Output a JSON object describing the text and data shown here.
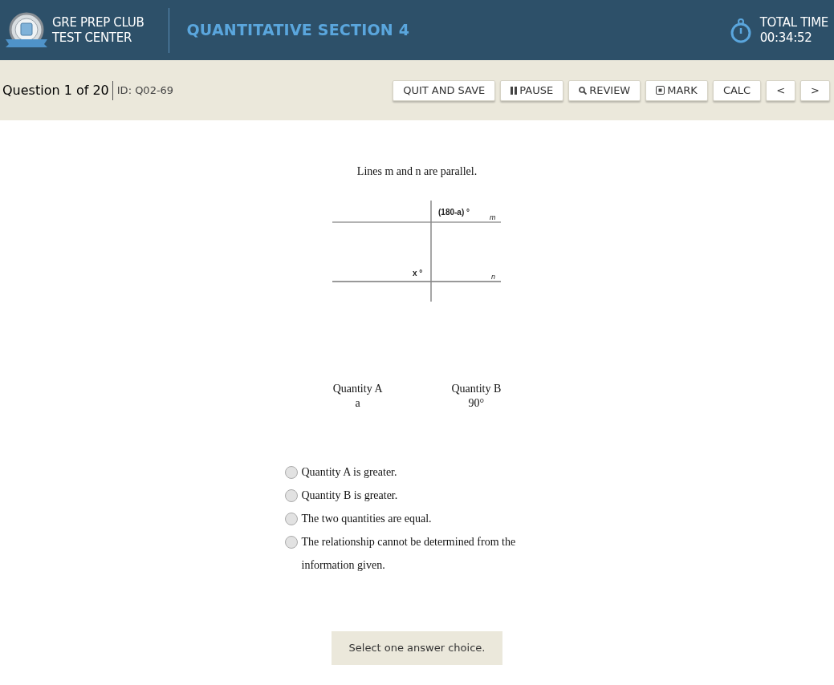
{
  "header": {
    "brand_lines": [
      "GRE PREP CLUB",
      "TEST CENTER"
    ],
    "section_title": "QUANTITATIVE SECTION 4",
    "timer_label": "TOTAL TIME",
    "timer_value": "00:34:52"
  },
  "toolbar": {
    "question_counter": "Question 1 of 20",
    "question_id": "ID: Q02-69",
    "buttons": [
      {
        "label": "QUIT AND SAVE",
        "kind": "plain"
      },
      {
        "label": "PAUSE",
        "kind": "pause"
      },
      {
        "label": "REVIEW",
        "kind": "review"
      },
      {
        "label": "MARK",
        "kind": "mark"
      },
      {
        "label": "CALC",
        "kind": "plain"
      },
      {
        "label": "<",
        "kind": "plain"
      },
      {
        "label": ">",
        "kind": "plain"
      }
    ]
  },
  "question": {
    "stem": "Lines m and n are parallel.",
    "figure_labels": {
      "top_angle": "(180-a) °",
      "line_m": "m",
      "bottom_angle": "x °",
      "line_n": "n"
    },
    "quantity_a": {
      "heading": "Quantity A",
      "value": "a"
    },
    "quantity_b": {
      "heading": "Quantity B",
      "value": "90°"
    },
    "choices": [
      {
        "text": "Quantity A is greater.",
        "selected": false
      },
      {
        "text": "Quantity B is greater.",
        "selected": false
      },
      {
        "text": "The two quantities are equal.",
        "selected": false
      },
      {
        "text": "The relationship cannot be determined from the information given.",
        "selected": false
      }
    ]
  },
  "footer_hint": "Select one answer choice."
}
